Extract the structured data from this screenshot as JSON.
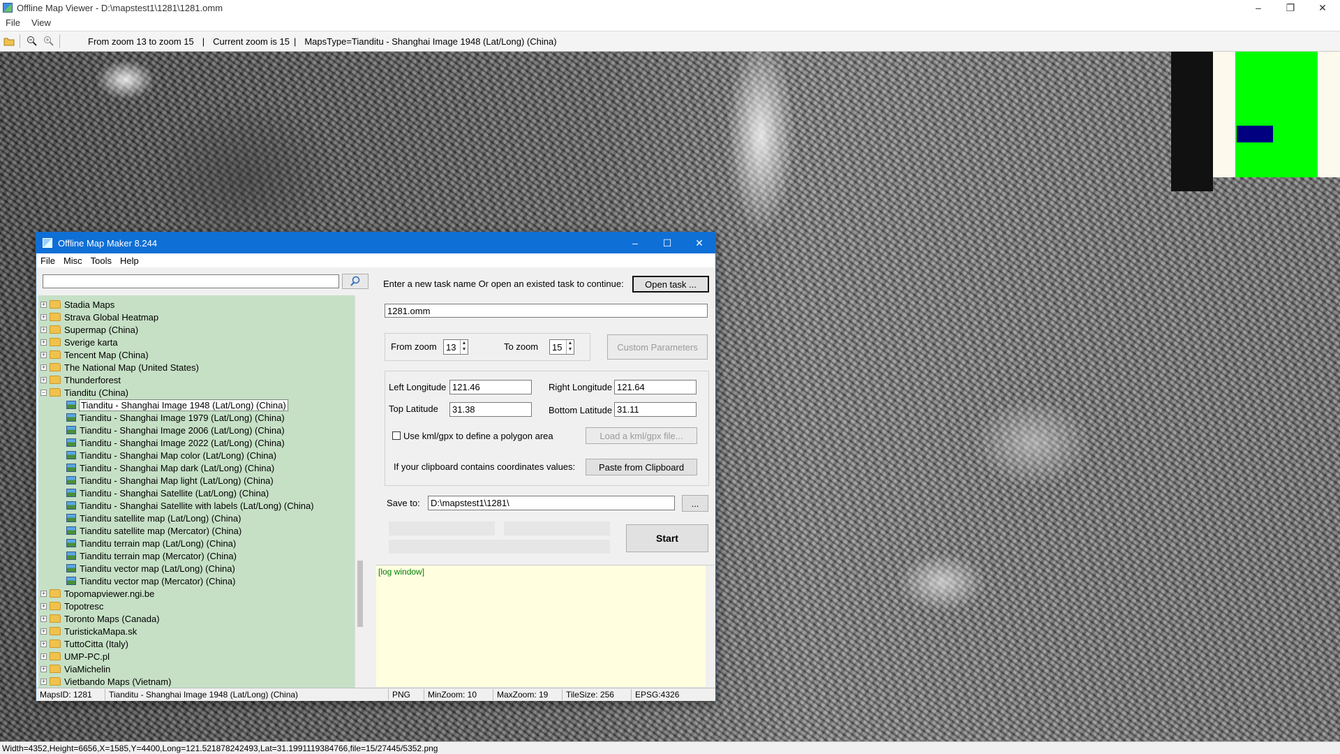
{
  "viewer": {
    "title": "Offline Map Viewer - D:\\mapstest1\\1281\\1281.omm",
    "menu": [
      "File",
      "View"
    ],
    "toolbar": {
      "zoom_range": "From zoom 13 to zoom 15",
      "sep1": "|",
      "current_zoom": "Current zoom is 15",
      "sep2": "|",
      "maps_type": "MapsType=Tianditu - Shanghai Image 1948 (Lat/Long) (China)"
    },
    "status": "Width=4352,Height=6656,X=1585,Y=4400,Long=121.521878242493,Lat=31.1991119384766,file=15/27445/5352.png"
  },
  "dialog": {
    "title": "Offline Map Maker 8.244",
    "menu": [
      "File",
      "Misc",
      "Tools",
      "Help"
    ],
    "search_value": "",
    "tree": [
      {
        "label": "Stadia Maps",
        "type": "folder"
      },
      {
        "label": "Strava Global Heatmap",
        "type": "folder"
      },
      {
        "label": "Supermap (China)",
        "type": "folder"
      },
      {
        "label": "Sverige karta",
        "type": "folder"
      },
      {
        "label": "Tencent Map (China)",
        "type": "folder"
      },
      {
        "label": "The National Map (United States)",
        "type": "folder"
      },
      {
        "label": "Thunderforest",
        "type": "folder"
      },
      {
        "label": "Tianditu (China)",
        "type": "folder-open"
      },
      {
        "label": "Tianditu - Shanghai Image 1948 (Lat/Long) (China)",
        "type": "map",
        "selected": true
      },
      {
        "label": "Tianditu - Shanghai Image 1979 (Lat/Long) (China)",
        "type": "map"
      },
      {
        "label": "Tianditu - Shanghai Image 2006 (Lat/Long) (China)",
        "type": "map"
      },
      {
        "label": "Tianditu - Shanghai Image 2022 (Lat/Long) (China)",
        "type": "map"
      },
      {
        "label": "Tianditu - Shanghai Map color (Lat/Long) (China)",
        "type": "map"
      },
      {
        "label": "Tianditu - Shanghai Map dark (Lat/Long) (China)",
        "type": "map"
      },
      {
        "label": "Tianditu - Shanghai Map light (Lat/Long) (China)",
        "type": "map"
      },
      {
        "label": "Tianditu - Shanghai Satellite (Lat/Long) (China)",
        "type": "map"
      },
      {
        "label": "Tianditu - Shanghai Satellite with labels (Lat/Long) (China)",
        "type": "map"
      },
      {
        "label": "Tianditu satellite map (Lat/Long) (China)",
        "type": "map"
      },
      {
        "label": "Tianditu satellite map (Mercator) (China)",
        "type": "map"
      },
      {
        "label": "Tianditu terrain map (Lat/Long) (China)",
        "type": "map"
      },
      {
        "label": "Tianditu terrain map (Mercator) (China)",
        "type": "map"
      },
      {
        "label": "Tianditu vector map (Lat/Long) (China)",
        "type": "map"
      },
      {
        "label": "Tianditu vector map (Mercator) (China)",
        "type": "map"
      },
      {
        "label": "Topomapviewer.ngi.be",
        "type": "folder"
      },
      {
        "label": "Topotresc",
        "type": "folder"
      },
      {
        "label": "Toronto Maps (Canada)",
        "type": "folder"
      },
      {
        "label": "TuristickaMapa.sk",
        "type": "folder"
      },
      {
        "label": "TuttoCitta (Italy)",
        "type": "folder"
      },
      {
        "label": "UMP-PC.pl",
        "type": "folder"
      },
      {
        "label": "ViaMichelin",
        "type": "folder"
      },
      {
        "label": "Vietbando Maps (Vietnam)",
        "type": "folder"
      }
    ],
    "task_prompt": "Enter a new task name Or open an existed task to continue:",
    "open_task": "Open task ...",
    "task_name": "1281.omm",
    "from_zoom_label": "From zoom",
    "from_zoom": "13",
    "to_zoom_label": "To zoom",
    "to_zoom": "15",
    "custom_params": "Custom Parameters",
    "left_lon_label": "Left Longitude",
    "left_lon": "121.46",
    "right_lon_label": "Right Longitude",
    "right_lon": "121.64",
    "top_lat_label": "Top Latitude",
    "top_lat": "31.38",
    "bottom_lat_label": "Bottom Latitude",
    "bottom_lat": "31.11",
    "kml_label": "Use kml/gpx to define a polygon area",
    "kml_checked": false,
    "load_kml": "Load a kml/gpx file...",
    "clipboard_label": "If your clipboard contains coordinates values:",
    "paste_clipboard": "Paste from Clipboard",
    "save_to_label": "Save to:",
    "save_to": "D:\\mapstest1\\1281\\",
    "browse": "...",
    "start": "Start",
    "log": "[log window]",
    "status": {
      "maps_id": "MapsID: 1281",
      "name": "Tianditu - Shanghai Image 1948 (Lat/Long) (China)",
      "format": "PNG",
      "min_zoom": "MinZoom: 10",
      "max_zoom": "MaxZoom: 19",
      "tile_size": "TileSize: 256",
      "epsg": "EPSG:4326"
    }
  },
  "colors": {
    "overview_land": "#00ff00",
    "overview_view": "#000080",
    "tree_bg": "#c6e0c6",
    "dialog_title": "#0e6fd6",
    "log_bg": "#ffffe0"
  }
}
